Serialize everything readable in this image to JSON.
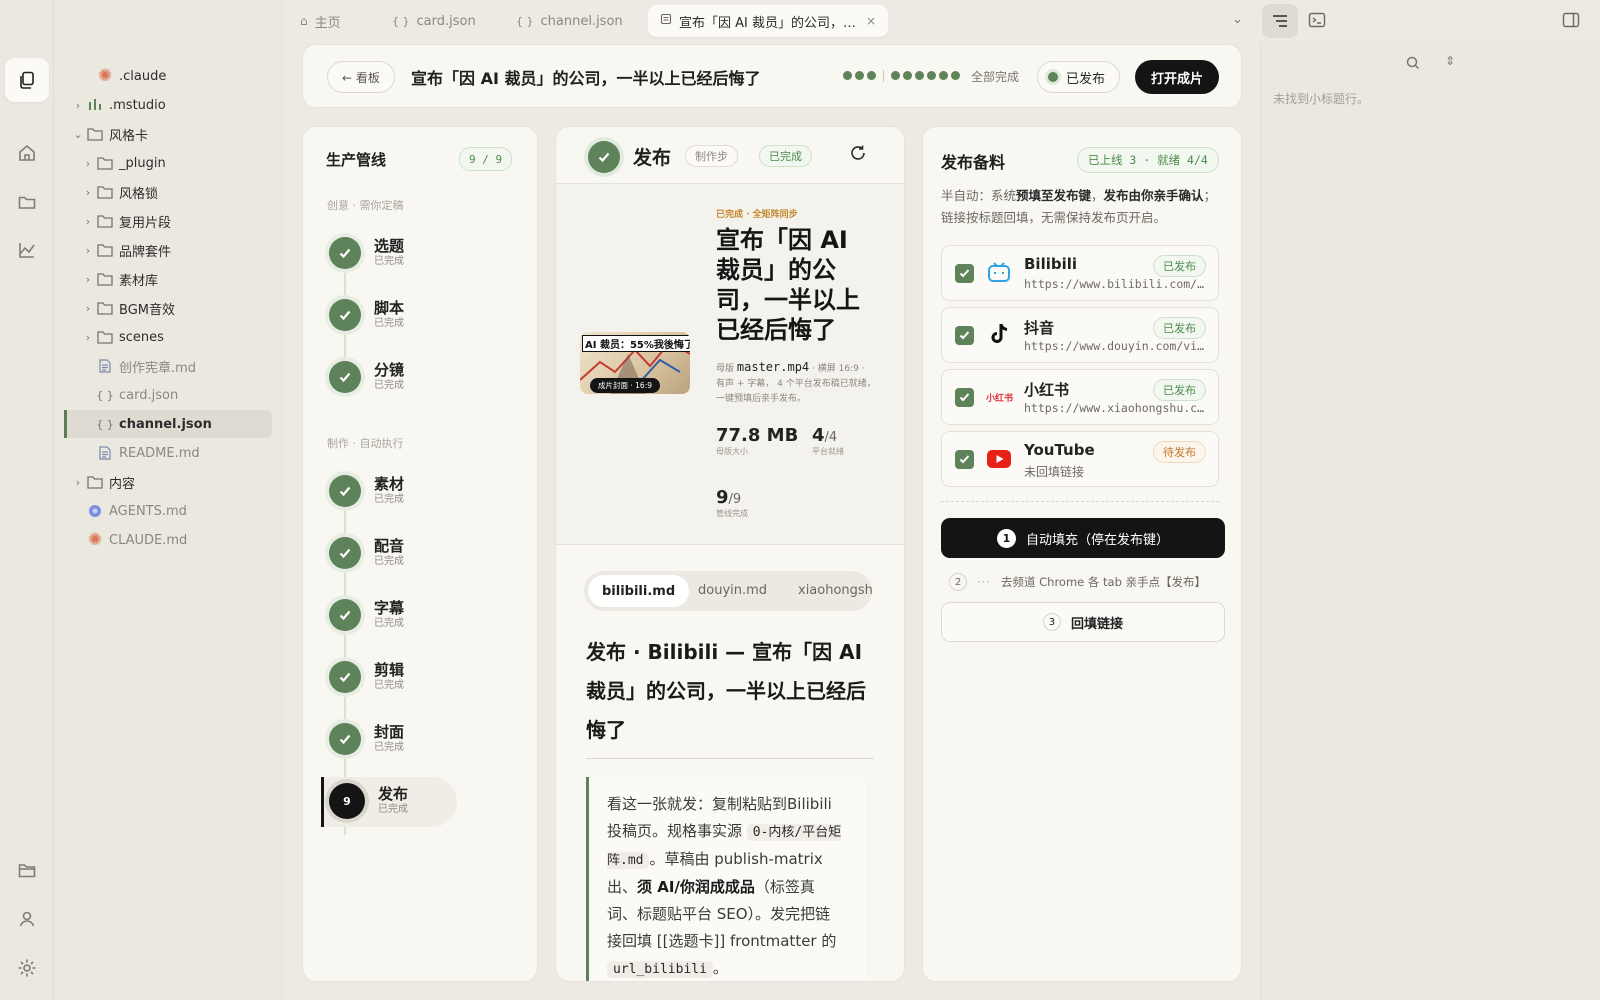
{
  "tabs": [
    {
      "label": "主页",
      "icon": "home-icon"
    },
    {
      "label": "card.json",
      "icon": "braces-icon"
    },
    {
      "label": "channel.json",
      "icon": "braces-icon"
    },
    {
      "label": "宣布「因 AI 裁员」的公司，…",
      "icon": "document-icon"
    }
  ],
  "filetree": [
    {
      "label": ".claude",
      "icon": "claude-asterisk-icon",
      "chevron": ""
    },
    {
      "label": ".mstudio",
      "icon": "bars-icon",
      "chevron": "›"
    },
    {
      "label": "风格卡",
      "icon": "folder-icon",
      "chevron": "⌄"
    },
    {
      "label": "_plugin",
      "icon": "folder-icon",
      "chevron": "›"
    },
    {
      "label": "风格锁",
      "icon": "folder-icon",
      "chevron": "›"
    },
    {
      "label": "复用片段",
      "icon": "folder-icon",
      "chevron": "›"
    },
    {
      "label": "品牌套件",
      "icon": "folder-icon",
      "chevron": "›"
    },
    {
      "label": "素材库",
      "icon": "folder-icon",
      "chevron": "›"
    },
    {
      "label": "BGM音效",
      "icon": "folder-icon",
      "chevron": "›"
    },
    {
      "label": "scenes",
      "icon": "folder-icon",
      "chevron": "›"
    },
    {
      "label": "创作宪章.md",
      "icon": "file-icon",
      "chevron": ""
    },
    {
      "label": "card.json",
      "icon": "braces-icon",
      "chevron": ""
    },
    {
      "label": "channel.json",
      "icon": "braces-icon",
      "chevron": ""
    },
    {
      "label": "README.md",
      "icon": "file-icon",
      "chevron": ""
    },
    {
      "label": "内容",
      "icon": "folder-icon",
      "chevron": "›"
    },
    {
      "label": "AGENTS.md",
      "icon": "agents-icon",
      "chevron": ""
    },
    {
      "label": "CLAUDE.md",
      "icon": "claude-asterisk-icon",
      "chevron": ""
    }
  ],
  "header": {
    "back_label": "← 看板",
    "title": "宣布「因 AI 裁员」的公司，一半以上已经后悔了",
    "progress_label": "全部完成",
    "status_label": "已发布",
    "open_button": "打开成片"
  },
  "pipeline": {
    "title": "生产管线",
    "count": "9 / 9",
    "section1": "创意 · 需你定稿",
    "section2": "制作 · 自动执行",
    "steps": [
      {
        "name": "选题",
        "status": "已完成"
      },
      {
        "name": "脚本",
        "status": "已完成"
      },
      {
        "name": "分镜",
        "status": "已完成"
      },
      {
        "name": "素材",
        "status": "已完成"
      },
      {
        "name": "配音",
        "status": "已完成"
      },
      {
        "name": "字幕",
        "status": "已完成"
      },
      {
        "name": "剪辑",
        "status": "已完成"
      },
      {
        "name": "封面",
        "status": "已完成"
      },
      {
        "name": "发布",
        "status": "已完成",
        "number": "9"
      }
    ]
  },
  "publish": {
    "title": "发布",
    "tag1": "制作步",
    "tag2": "已完成",
    "kicker": "已完成 · 全矩阵同步",
    "headline": "宣布「因 AI 裁员」的公司，一半以上已经后悔了",
    "master_prefix": "母版",
    "master_file": "master.mp4",
    "master_ratio": "· 横屏 16:9",
    "meta_desc": "· 有声 + 字幕， 4 个平台发布稿已就绪，一键预填后亲手发布。",
    "size_value": "77.8 MB",
    "size_label": "母版大小",
    "platform_value": "4",
    "platform_total": "/4",
    "platform_label": "平台就绪",
    "pipeline_value": "9",
    "pipeline_total": "/9",
    "pipeline_label": "管线完成",
    "thumb_badge": "成片封面 · 16:9",
    "thumb_text": "AI 裁员：55%我後悔了",
    "doc_tabs": [
      "bilibili.md",
      "douyin.md",
      "xiaohongsh"
    ],
    "doc_title": "发布 · Bilibili — 宣布「因 AI 裁员」的公司，一半以上已经后悔了",
    "quote": {
      "p1": "看这一张就发：复制粘贴到Bilibili投稿页。规格事实源 ",
      "code1": "0-内核/平台矩阵.md",
      "p2": "。草稿由 publish-matrix 出、",
      "bold": "须 AI/你润成成品",
      "p3": "（标签真词、标题贴平台 SEO）。发完把链接回填 [[选题卡]] frontmatter 的 ",
      "code2": "url_bilibili",
      "p4": "。"
    }
  },
  "release": {
    "title": "发布备料",
    "badge": "已上线 3 · 就绪 4/4",
    "desc_a": "半自动：系统",
    "desc_b": "预填至发布键",
    "desc_c": "，",
    "desc_d": "发布由你亲手确认",
    "desc_e": "；链接按标题回填，无需保持发布页开启。",
    "platforms": [
      {
        "name": "Bilibili",
        "url": "https://www.bilibili.com/video/",
        "status": "已发布",
        "icon": "bilibili-icon"
      },
      {
        "name": "抖音",
        "url": "https://www.douyin.com/video/",
        "status": "已发布",
        "icon": "douyin-icon"
      },
      {
        "name": "小红书",
        "url": "https://www.xiaohongshu.com/",
        "status": "已发布",
        "icon": "xiaohongshu-icon",
        "logo_text": "小红书"
      },
      {
        "name": "YouTube",
        "url": "未回填链接",
        "status": "待发布",
        "icon": "youtube-icon"
      }
    ],
    "action1_num": "1",
    "action1": "自动填充（停在发布键）",
    "action2_num": "2",
    "action2": "去频道 Chrome 各 tab 亲手点【发布】",
    "action3_num": "3",
    "action3": "回填链接"
  },
  "outline": {
    "empty": "未找到小标题行。"
  },
  "colors": {
    "accent": "#5e8259",
    "dark": "#141414",
    "bg": "#eceae3"
  }
}
